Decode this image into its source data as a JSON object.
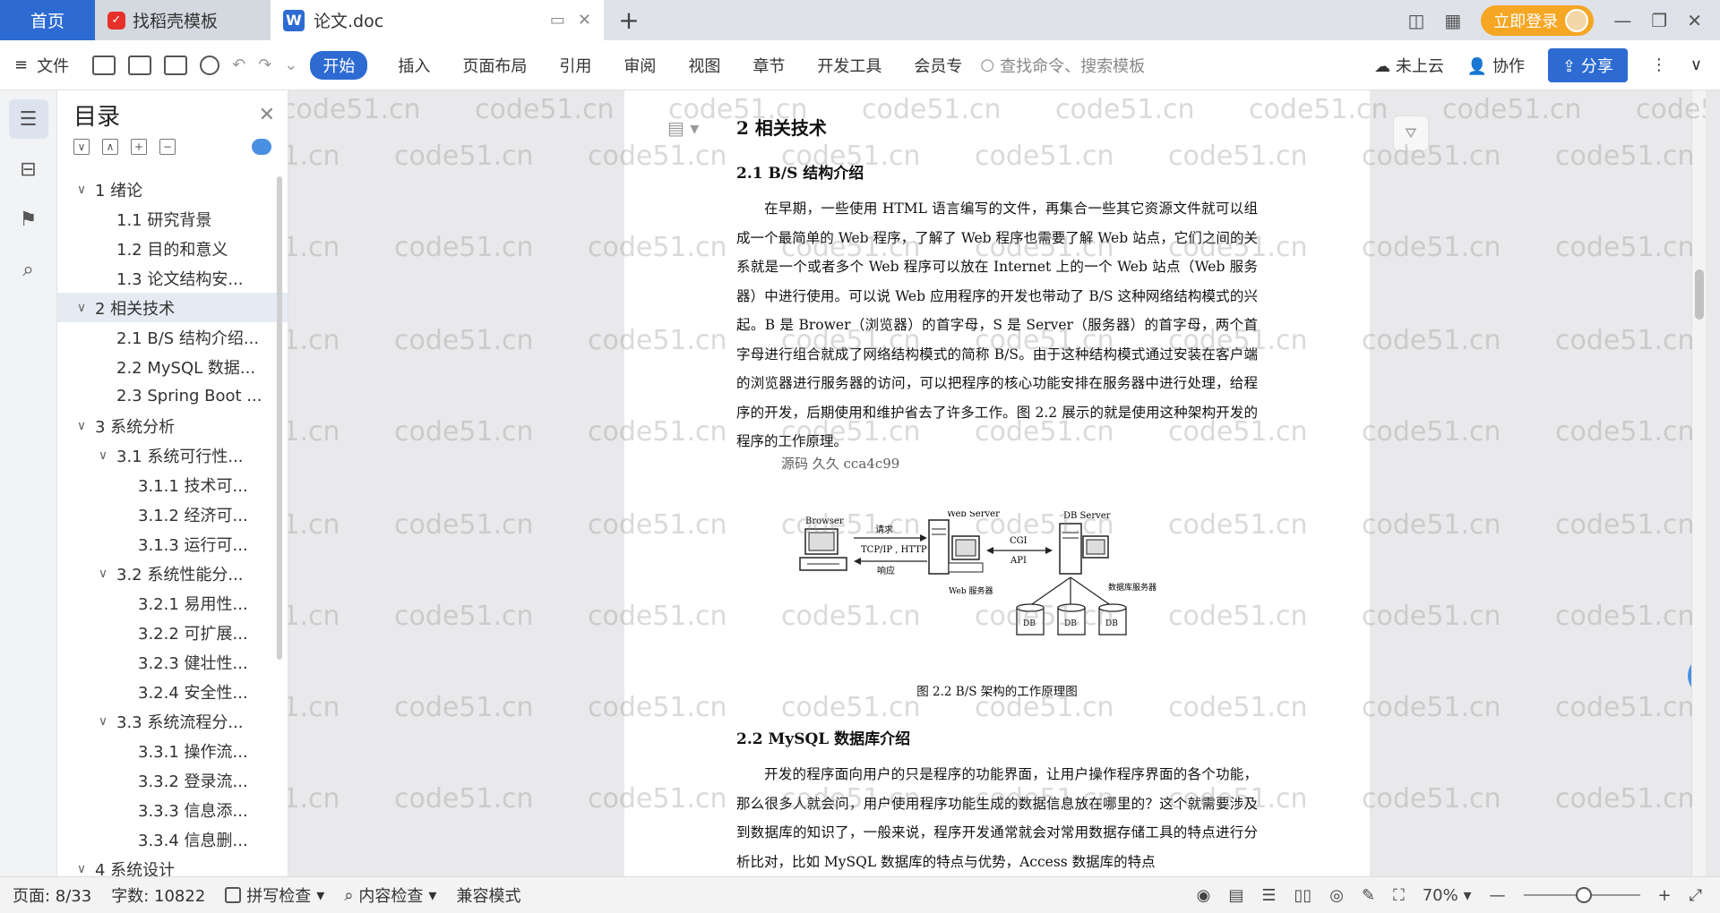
{
  "tabs": {
    "home": "首页",
    "template": "找稻壳模板",
    "doc": "论文.doc",
    "new_tab": "+"
  },
  "account": {
    "login": "立即登录"
  },
  "toolbar": {
    "file": "文件",
    "menu": [
      "开始",
      "插入",
      "页面布局",
      "引用",
      "审阅",
      "视图",
      "章节",
      "开发工具",
      "会员专"
    ],
    "search_placeholder": "查找命令、搜索模板",
    "cloud": "未上云",
    "collab": "协作",
    "share": "分享"
  },
  "toc": {
    "title": "目录",
    "items": [
      {
        "text": "1  绪论",
        "level": 1,
        "chev": "∨"
      },
      {
        "text": "1.1  研究背景",
        "level": 2
      },
      {
        "text": "1.2  目的和意义",
        "level": 2
      },
      {
        "text": "1.3  论文结构安...",
        "level": 2
      },
      {
        "text": "2  相关技术",
        "level": 1,
        "chev": "∨",
        "selected": true
      },
      {
        "text": "2.1 B/S 结构介绍...",
        "level": 2
      },
      {
        "text": "2.2 MySQL 数据...",
        "level": 2
      },
      {
        "text": "2.3 Spring Boot ...",
        "level": 2
      },
      {
        "text": "3  系统分析",
        "level": 1,
        "chev": "∨"
      },
      {
        "text": "3.1  系统可行性...",
        "level": 2,
        "chev": "∨"
      },
      {
        "text": "3.1.1  技术可...",
        "level": 3
      },
      {
        "text": "3.1.2  经济可...",
        "level": 3
      },
      {
        "text": "3.1.3  运行可...",
        "level": 3
      },
      {
        "text": "3.2  系统性能分...",
        "level": 2,
        "chev": "∨"
      },
      {
        "text": "3.2.1  易用性...",
        "level": 3
      },
      {
        "text": "3.2.2  可扩展...",
        "level": 3
      },
      {
        "text": "3.2.3  健壮性...",
        "level": 3
      },
      {
        "text": "3.2.4  安全性...",
        "level": 3
      },
      {
        "text": "3.3  系统流程分...",
        "level": 2,
        "chev": "∨"
      },
      {
        "text": "3.3.1  操作流...",
        "level": 3
      },
      {
        "text": "3.3.2  登录流...",
        "level": 3
      },
      {
        "text": "3.3.3  信息添...",
        "level": 3
      },
      {
        "text": "3.3.4  信息删...",
        "level": 3
      },
      {
        "text": "4  系统设计",
        "level": 1,
        "chev": "∨"
      }
    ]
  },
  "doc": {
    "h1": "2  相关技术",
    "h2_1": "2.1 B/S 结构介绍",
    "p1": "在早期，一些使用 HTML 语言编写的文件，再集合一些其它资源文件就可以组成一个最简单的 Web 程序，了解了 Web 程序也需要了解 Web 站点，它们之间的关系就是一个或者多个 Web 程序可以放在 Internet 上的一个 Web 站点（Web 服务器）中进行使用。可以说 Web 应用程序的开发也带动了 B/S 这种网络结构模式的兴起。B 是 Brower（浏览器）的首字母，S 是 Server（服务器）的首字母，两个首字母进行组合就成了网络结构模式的简称 B/S。由于这种结构模式通过安装在客户端的浏览器进行服务器的访问，可以把程序的核心功能安排在服务器中进行处理，给程序的开发，后期使用和维护省去了许多工作。图 2.2 展示的就是使用这种架构开发的程序的工作原理。",
    "overlay": "源码 久久 cca4c99",
    "fig_labels": {
      "browser": "Browser",
      "web_server": "Web Server",
      "db_server": "DB Server",
      "req": "请求",
      "proto": "TCP/IP , HTTP",
      "resp": "响应",
      "cgi": "CGI",
      "api": "API",
      "web_svr_cn": "Web 服务器",
      "db_svr_cn": "数据库服务器",
      "db": "DB"
    },
    "fig_caption": "图 2.2 B/S 架构的工作原理图",
    "h2_2": "2.2 MySQL 数据库介绍",
    "p2": "开发的程序面向用户的只是程序的功能界面，让用户操作程序界面的各个功能，那么很多人就会问，用户使用程序功能生成的数据信息放在哪里的？这个就需要涉及到数据库的知识了，一般来说，程序开发通常就会对常用数据存储工具的特点进行分析比对，比如 MySQL 数据库的特点与优势，Access 数据库的特点"
  },
  "watermark": "code51.cn",
  "status": {
    "page": "页面: 8/33",
    "words": "字数: 10822",
    "spell": "拼写检查",
    "content": "内容检查",
    "compat": "兼容模式",
    "zoom": "70%"
  }
}
